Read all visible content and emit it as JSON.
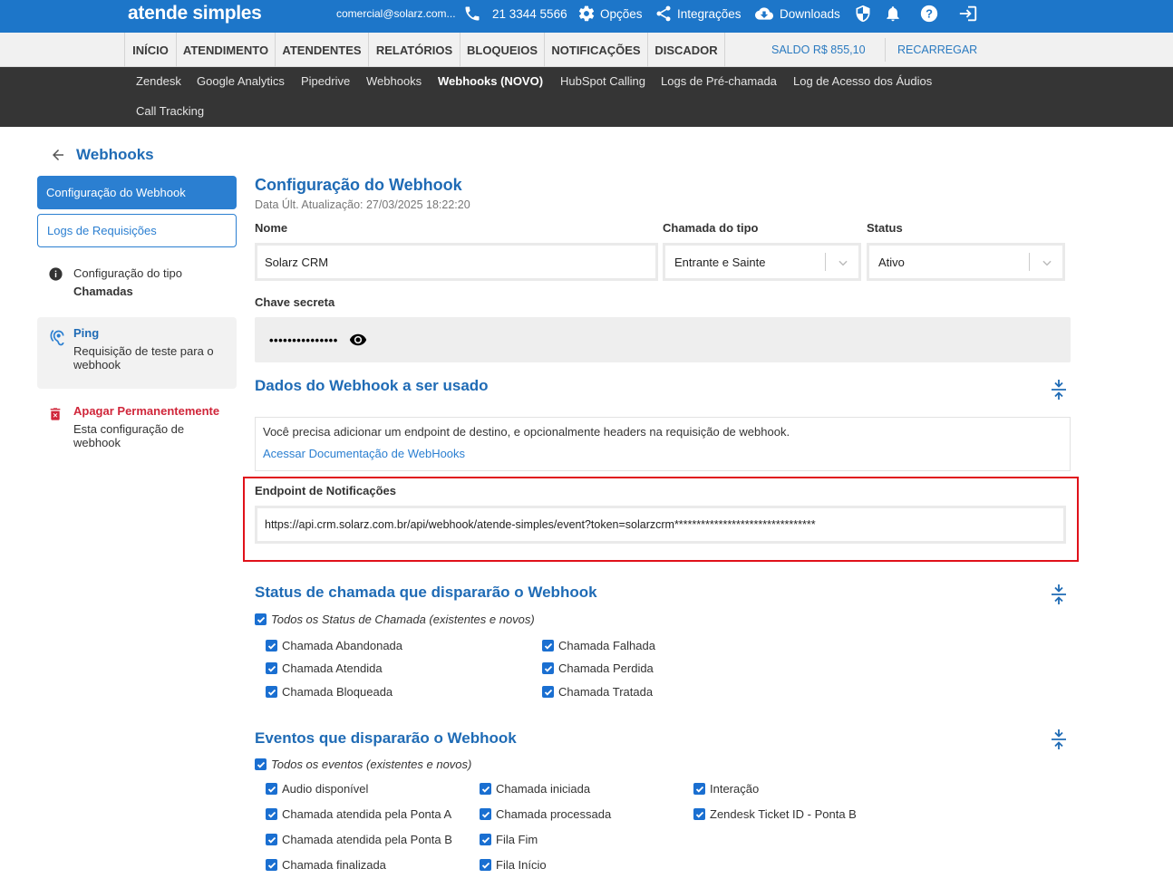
{
  "app": {
    "logo": "atende simples",
    "email": "comercial@solarz.com...",
    "phone": "21 3344 5566",
    "options": "Opções",
    "integrations": "Integrações",
    "downloads": "Downloads"
  },
  "nav": {
    "items": [
      "INÍCIO",
      "ATENDIMENTO",
      "ATENDENTES",
      "RELATÓRIOS",
      "BLOQUEIOS",
      "NOTIFICAÇÕES",
      "DISCADOR"
    ],
    "balance": "SALDO R$ 855,10",
    "recharge": "RECARREGAR"
  },
  "subnav": {
    "items": [
      "Zendesk",
      "Google Analytics",
      "Pipedrive",
      "Webhooks",
      "Webhooks (NOVO)",
      "HubSpot Calling",
      "Logs de Pré-chamada",
      "Log de Acesso dos Áudios",
      "Call Tracking"
    ],
    "active": "Webhooks (NOVO)"
  },
  "sidebar": {
    "back_title": "Webhooks",
    "config_btn": "Configuração do Webhook",
    "logs_btn": "Logs de Requisições",
    "type_label": "Configuração do tipo",
    "type_value": "Chamadas",
    "ping_title": "Ping",
    "ping_desc": "Requisição de teste para o webhook",
    "delete_title": "Apagar Permanentemente",
    "delete_desc": "Esta configuração de webhook"
  },
  "main": {
    "title": "Configuração do Webhook",
    "updated": "Data Últ. Atualização: 27/03/2025 18:22:20",
    "name_label": "Nome",
    "name_value": "Solarz CRM",
    "type_label": "Chamada do tipo",
    "type_value": "Entrante e Sainte",
    "status_label": "Status",
    "status_value": "Ativo",
    "secret_label": "Chave secreta",
    "secret_value": "•••••••••••••••",
    "data_section_title": "Dados do Webhook a ser usado",
    "info_text": "Você precisa adicionar um endpoint de destino, e opcionalmente headers na requisição de webhook.",
    "info_link": "Acessar Documentação de WebHooks",
    "endpoint_label": "Endpoint de Notificações",
    "endpoint_value": "https://api.crm.solarz.com.br/api/webhook/atende-simples/event?token=solarzcrm********************************",
    "status_section": {
      "title": "Status de chamada que dispararão o Webhook",
      "all_label": "Todos os Status de Chamada (existentes e novos)",
      "col1": [
        "Chamada Abandonada",
        "Chamada Atendida",
        "Chamada Bloqueada"
      ],
      "col2": [
        "Chamada Falhada",
        "Chamada Perdida",
        "Chamada Tratada"
      ]
    },
    "events_section": {
      "title": "Eventos que dispararão o Webhook",
      "all_label": "Todos os eventos (existentes e novos)",
      "col1": [
        "Audio disponível",
        "Chamada atendida pela Ponta A",
        "Chamada atendida pela Ponta B",
        "Chamada finalizada"
      ],
      "col2": [
        "Chamada iniciada",
        "Chamada processada",
        "Fila Fim",
        "Fila Início"
      ],
      "col3": [
        "Interação",
        "Zendesk Ticket ID - Ponta B"
      ]
    }
  },
  "colors": {
    "primary": "#1d76c9",
    "accent_blue": "#1f6bb5",
    "danger": "#d0263a",
    "highlight": "#e0111a",
    "subnav_bg": "#353535"
  }
}
